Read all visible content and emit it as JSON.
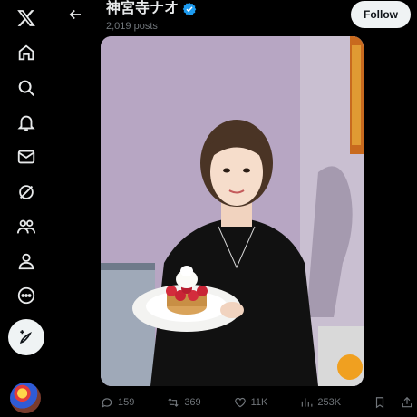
{
  "profile": {
    "name": "神宮寺ナオ",
    "posts_count": "2,019 posts",
    "follow_label": "Follow"
  },
  "actions": {
    "replies": "159",
    "reposts": "369",
    "likes": "11K",
    "views": "253K"
  },
  "icons": {
    "nav": [
      "x-logo-icon",
      "home-icon",
      "search-icon",
      "notifications-icon",
      "messages-icon",
      "grok-icon",
      "communities-icon",
      "profile-icon",
      "more-icon"
    ],
    "post": "compose-post-icon"
  },
  "colors": {
    "background": "#000000",
    "verified": "#1d9bf0",
    "muted": "#71767b",
    "text": "#e7e9ea"
  }
}
